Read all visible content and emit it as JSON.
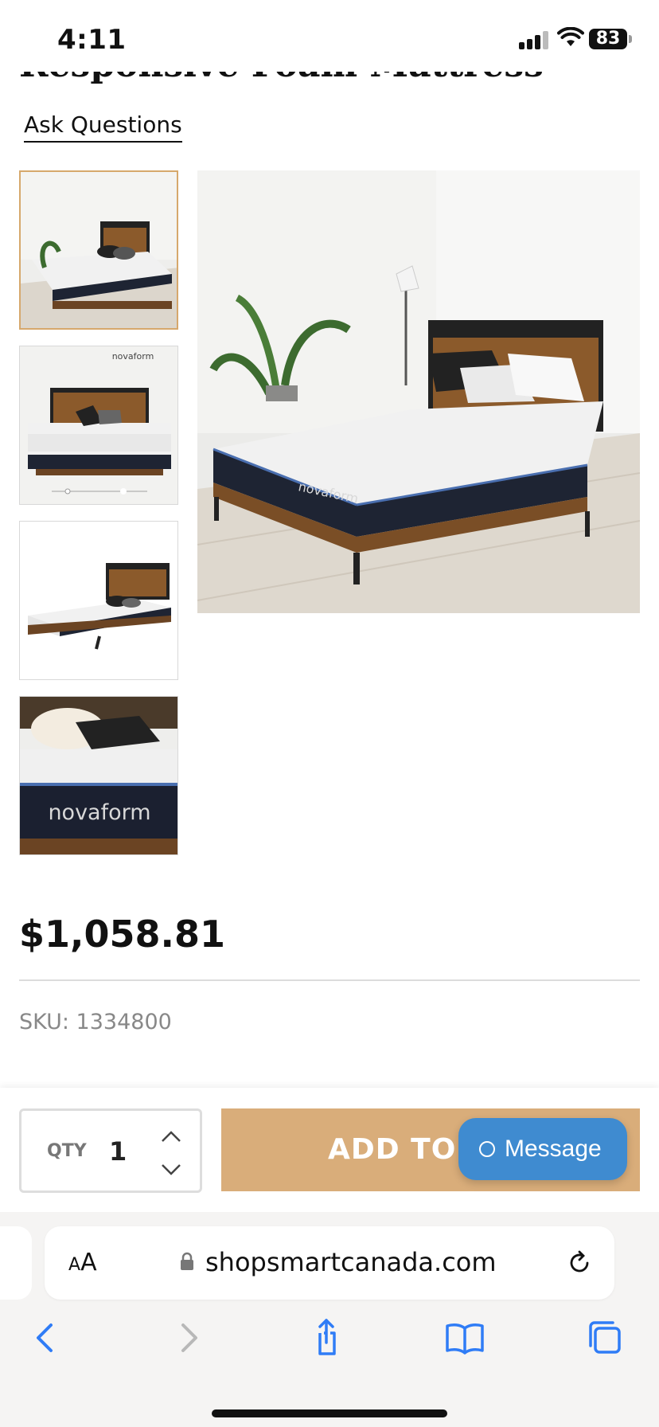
{
  "status_bar": {
    "time": "4:11",
    "battery": "83"
  },
  "product": {
    "title": "Responsive Foam Mattress",
    "ask_questions": "Ask Questions",
    "price": "$1,058.81",
    "sku": "SKU: 1334800",
    "brand_on_image": "novaform"
  },
  "cart_bar": {
    "qty_label": "QTY",
    "qty_value": "1",
    "add_to_cart": "ADD TO C",
    "message": "Message"
  },
  "browser": {
    "aa_label_small": "A",
    "aa_label_large": "A",
    "url": "shopsmartcanada.com"
  },
  "colors": {
    "accent_gold": "#d9ad7a",
    "message_blue": "#3f8bd0",
    "ios_blue": "#2f7cf6"
  }
}
